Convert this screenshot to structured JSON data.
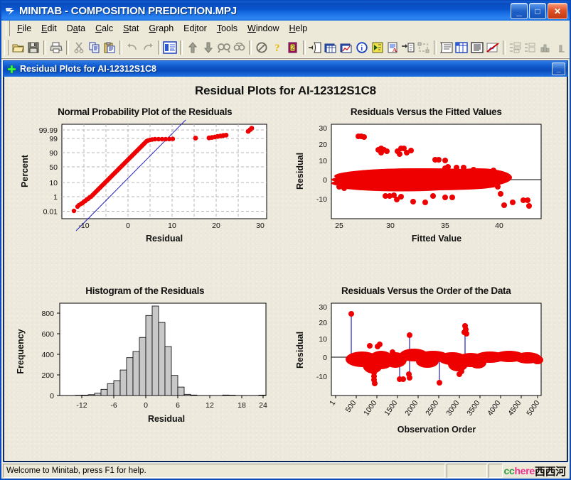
{
  "window": {
    "title": "MINITAB - COMPOSITION PREDICTION.MPJ",
    "app_icon": "minitab-icon",
    "minimize_label": "_",
    "maximize_label": "□",
    "close_label": "✕"
  },
  "menu": {
    "items": [
      {
        "label": "File",
        "accel": "F"
      },
      {
        "label": "Edit",
        "accel": "E"
      },
      {
        "label": "Data",
        "accel": "a"
      },
      {
        "label": "Calc",
        "accel": "C"
      },
      {
        "label": "Stat",
        "accel": "S"
      },
      {
        "label": "Graph",
        "accel": "G"
      },
      {
        "label": "Editor",
        "accel": "i"
      },
      {
        "label": "Tools",
        "accel": "T"
      },
      {
        "label": "Window",
        "accel": "W"
      },
      {
        "label": "Help",
        "accel": "H"
      }
    ]
  },
  "toolbar": {
    "buttons": [
      "open-icon",
      "save-icon",
      "print-icon",
      "cut-icon",
      "copy-icon",
      "paste-icon",
      "undo-icon",
      "redo-icon",
      "session-window-icon",
      "move-up-icon",
      "move-down-icon",
      "find-icon",
      "find-replace-icon",
      "cancel-icon",
      "help-icon",
      "stat-guide-icon",
      "previous-command-icon",
      "worksheet-icon",
      "graph-window-icon",
      "info-icon",
      "history-icon",
      "report-pad-icon",
      "next-command-icon",
      "project-manager-icon",
      "session-icon",
      "current-worksheet-icon",
      "worksheets-icon",
      "close-all-graphs-icon",
      "dotplot-icon",
      "boxplot-icon",
      "histogram-icon",
      "chart-icon"
    ]
  },
  "document": {
    "title": "Residual Plots for AI-12312S1C8",
    "icon": "graph-window-icon",
    "minimize_label": "_"
  },
  "statusbar": {
    "message": "Welcome to Minitab, press F1 for help.",
    "watermark": {
      "cc": "cc",
      "here": "here",
      "cn": "西西河"
    }
  },
  "graph": {
    "title": "Residual Plots for AI-12312S1C8"
  },
  "chart_data": [
    {
      "type": "scatter",
      "title": "Normal Probability Plot of the Residuals",
      "xlabel": "Residual",
      "ylabel": "Percent",
      "xlim": [
        -16,
        31
      ],
      "ylim_percent_ticks": [
        "0.01",
        "1",
        "10",
        "50",
        "90",
        "99",
        "99.99"
      ],
      "xticks": [
        -10,
        0,
        10,
        20,
        30
      ],
      "grid": true,
      "point_color": "#EE0000",
      "fit_line_color": "#2222BB",
      "description": "S-shaped point cloud rising from (-13.5, 0.01) through (0, 50) to (9, 99.3); isolated outlier clusters near x=14, x=16-20 at ~99.4 and x=26-28 at ~99.9. Blue normal reference line drawn through the central distribution.",
      "reference_line": {
        "x1": -13.0,
        "y1_percent": 0.003,
        "x2": 14.5,
        "y2_percent": 99.995
      },
      "points": [
        {
          "x": -13.5,
          "p": 0.012
        },
        {
          "x": -12.6,
          "p": 0.04
        },
        {
          "x": -12.4,
          "p": 0.06
        },
        {
          "x": -11.8,
          "p": 0.1
        },
        {
          "x": -11.4,
          "p": 0.14
        },
        {
          "x": -11.0,
          "p": 0.2
        },
        {
          "x": -10.6,
          "p": 0.3
        },
        {
          "x": -10.2,
          "p": 0.45
        },
        {
          "x": -9.8,
          "p": 0.65
        },
        {
          "x": -9.4,
          "p": 0.9
        },
        {
          "x": -9.0,
          "p": 1.2
        },
        {
          "x": -8.6,
          "p": 1.6
        },
        {
          "x": -8.2,
          "p": 2.2
        },
        {
          "x": -7.8,
          "p": 3.0
        },
        {
          "x": -7.4,
          "p": 4.0
        },
        {
          "x": -7.0,
          "p": 5.2
        },
        {
          "x": -6.6,
          "p": 6.6
        },
        {
          "x": -6.2,
          "p": 8.2
        },
        {
          "x": -5.8,
          "p": 10.0
        },
        {
          "x": -5.4,
          "p": 12.0
        },
        {
          "x": -5.0,
          "p": 14.5
        },
        {
          "x": -4.6,
          "p": 17.0
        },
        {
          "x": -4.2,
          "p": 20.0
        },
        {
          "x": -3.8,
          "p": 23.0
        },
        {
          "x": -3.4,
          "p": 26.5
        },
        {
          "x": -3.0,
          "p": 30.0
        },
        {
          "x": -2.6,
          "p": 34.0
        },
        {
          "x": -2.2,
          "p": 38.0
        },
        {
          "x": -1.8,
          "p": 42.0
        },
        {
          "x": -1.4,
          "p": 46.0
        },
        {
          "x": -1.0,
          "p": 50.0
        },
        {
          "x": -0.6,
          "p": 54.0
        },
        {
          "x": -0.2,
          "p": 58.0
        },
        {
          "x": 0.3,
          "p": 62.0
        },
        {
          "x": 0.8,
          "p": 66.0
        },
        {
          "x": 1.3,
          "p": 70.0
        },
        {
          "x": 1.8,
          "p": 74.0
        },
        {
          "x": 2.3,
          "p": 78.0
        },
        {
          "x": 2.8,
          "p": 82.0
        },
        {
          "x": 3.3,
          "p": 86.0
        },
        {
          "x": 3.8,
          "p": 90.0
        },
        {
          "x": 4.2,
          "p": 93.0
        },
        {
          "x": 4.6,
          "p": 95.5
        },
        {
          "x": 5.0,
          "p": 97.2
        },
        {
          "x": 5.3,
          "p": 98.4
        },
        {
          "x": 5.6,
          "p": 99.0
        },
        {
          "x": 6.0,
          "p": 99.2
        },
        {
          "x": 6.6,
          "p": 99.25
        },
        {
          "x": 7.4,
          "p": 99.28
        },
        {
          "x": 8.2,
          "p": 99.3
        },
        {
          "x": 9.0,
          "p": 99.32
        },
        {
          "x": 13.7,
          "p": 99.4
        },
        {
          "x": 16.3,
          "p": 99.45
        },
        {
          "x": 17.0,
          "p": 99.5
        },
        {
          "x": 17.8,
          "p": 99.55
        },
        {
          "x": 18.6,
          "p": 99.6
        },
        {
          "x": 19.4,
          "p": 99.65
        },
        {
          "x": 20.0,
          "p": 99.68
        },
        {
          "x": 26.8,
          "p": 99.93
        },
        {
          "x": 27.2,
          "p": 99.96
        },
        {
          "x": 27.5,
          "p": 99.98
        }
      ]
    },
    {
      "type": "scatter",
      "title": "Residuals Versus the Fitted Values",
      "xlabel": "Fitted Value",
      "ylabel": "Residual",
      "xlim": [
        24.5,
        41
      ],
      "ylim": [
        -16,
        30
      ],
      "xticks": [
        25,
        30,
        35,
        40
      ],
      "yticks": [
        -10,
        0,
        10,
        20,
        30
      ],
      "grid": false,
      "point_color": "#EE0000",
      "zero_line": 0,
      "description": "Dense horizontal band of residuals between about -8 and +6 spanning fitted values 25.5 to 39; outliers at ~27.6 with residual 27, a cluster near fitted 29-31 with residuals 16-19, points near 33.5-34 at 13.5, and low outliers near 39-40.5 at -11 to -14."
    },
    {
      "type": "bar",
      "title": "Histogram of the Residuals",
      "xlabel": "Residual",
      "ylabel": "Frequency",
      "xticks": [
        -12,
        -6,
        0,
        6,
        12,
        18,
        24
      ],
      "yticks": [
        0,
        200,
        400,
        600,
        800
      ],
      "ylim": [
        0,
        900
      ],
      "xlim": [
        -15,
        28
      ],
      "bar_fill": "#C8C8C8",
      "bar_stroke": "#000000",
      "bin_width": 1.5,
      "bin_centers": [
        -13.5,
        -12,
        -10.5,
        -9,
        -7.5,
        -6,
        -4.5,
        -3,
        -1.5,
        0,
        1.5,
        3,
        4.5,
        6,
        7.5,
        9,
        18,
        19.5,
        27
      ],
      "values": [
        3,
        4,
        8,
        22,
        60,
        115,
        145,
        248,
        368,
        428,
        565,
        778,
        868,
        710,
        475,
        195,
        82,
        12,
        5,
        3,
        4
      ]
    },
    {
      "type": "line",
      "title": "Residuals Versus the Order of the Data",
      "xlabel": "Observation Order",
      "ylabel": "Residual",
      "xticks": [
        "1",
        "500",
        "1000",
        "1500",
        "2000",
        "2500",
        "3000",
        "3500",
        "4000",
        "4500",
        "5000"
      ],
      "yticks": [
        -10,
        0,
        10,
        20,
        30
      ],
      "ylim": [
        -16,
        30
      ],
      "point_color": "#EE0000",
      "line_color": "#2222BB",
      "zero_line": 0,
      "description": "Connected-stem series of ~5300 residuals oscillating about zero between -15 and +10, with a spike to 27 near observation 150, a spike to 14 near 1450, a cluster to 18-20 near 3250, and dips to -15 near 800 and -13 near 2450."
    }
  ]
}
